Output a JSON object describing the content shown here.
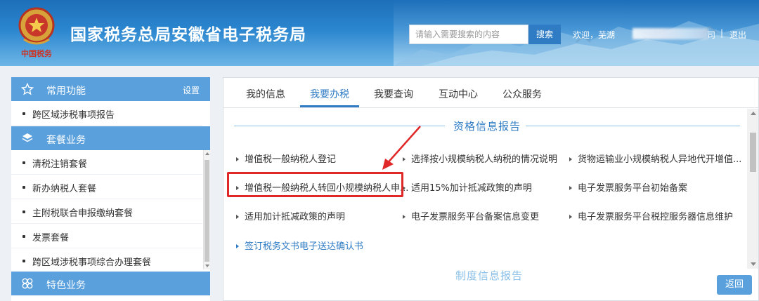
{
  "header": {
    "title": "国家税务总局安徽省电子税务局",
    "emblem_caption": "中国税务",
    "search": {
      "placeholder": "请输入需要搜索的内容",
      "button_label": "搜索"
    },
    "user": {
      "welcome": "欢迎，芜湖",
      "name_tail": "司",
      "separator": "|",
      "logout_label": "退出"
    },
    "colors": {
      "primary": "#2f7cc4",
      "header_top": "#1d6fb9",
      "header_bottom": "#6db6e6"
    }
  },
  "sidebar": {
    "common": {
      "label": "常用功能",
      "icon": "star-icon",
      "setting_label": "设置"
    },
    "common_items": [
      "跨区域涉税事项报告"
    ],
    "package": {
      "label": "套餐业务",
      "icon": "layers-icon"
    },
    "package_items": [
      "清税注销套餐",
      "新办纳税人套餐",
      "主附税联合申报缴纳套餐",
      "发票套餐",
      "跨区域涉税事项综合办理套餐"
    ],
    "special": {
      "label": "特色业务",
      "icon": "clover-icon"
    }
  },
  "main": {
    "tabs": [
      "我的信息",
      "我要办税",
      "我要查询",
      "互动中心",
      "公众服务"
    ],
    "active_tab": "我要办税",
    "section_title": "资格信息报告",
    "items": [
      "增值税一般纳税人登记",
      "选择按小规模纳税人纳税的情况说明",
      "货物运输业小规模纳税人异地代开增值...",
      "增值税一般纳税人转回小规模纳税人申...",
      "适用15%加计抵减政策的声明",
      "电子发票服务平台初始备案",
      "适用加计抵减政策的声明",
      "电子发票服务平台备案信息变更",
      "电子发票服务平台税控服务器信息维护",
      "签订税务文书电子送达确认书"
    ],
    "next_section_title": "制度信息报告",
    "highlight_color": "#e02828",
    "back_label": "返回"
  }
}
